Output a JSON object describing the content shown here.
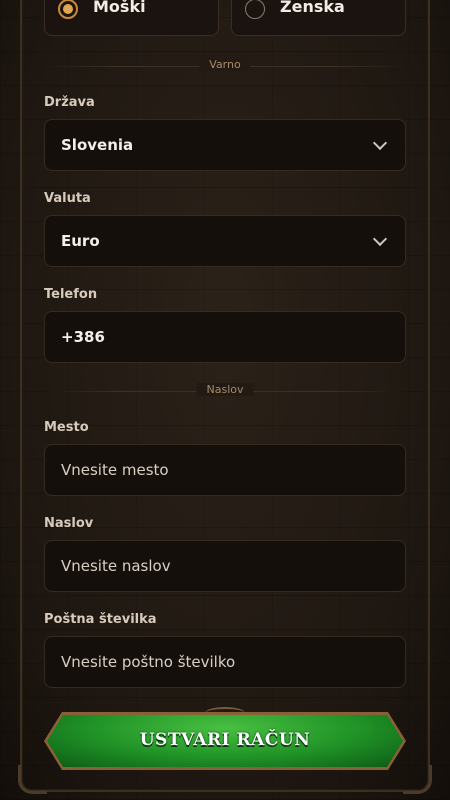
{
  "gender": {
    "male_label": "Moški",
    "female_label": "Ženska",
    "selected": "male"
  },
  "sections": {
    "security": "Varno",
    "address": "Naslov"
  },
  "fields": {
    "country": {
      "label": "Država",
      "value": "Slovenia"
    },
    "currency": {
      "label": "Valuta",
      "value": "Euro"
    },
    "phone": {
      "label": "Telefon",
      "value": "+386"
    },
    "city": {
      "label": "Mesto",
      "placeholder": "Vnesite mesto"
    },
    "address": {
      "label": "Naslov",
      "placeholder": "Vnesite naslov"
    },
    "postal": {
      "label": "Poštna številka",
      "placeholder": "Vnesite poštno številko"
    }
  },
  "submit": {
    "label": "USTVARI RAČUN"
  },
  "colors": {
    "accent": "#e0a552",
    "button_green": "#1f9126",
    "field_bg": "#150f0c"
  },
  "icons": [
    "chevron-down-icon"
  ]
}
